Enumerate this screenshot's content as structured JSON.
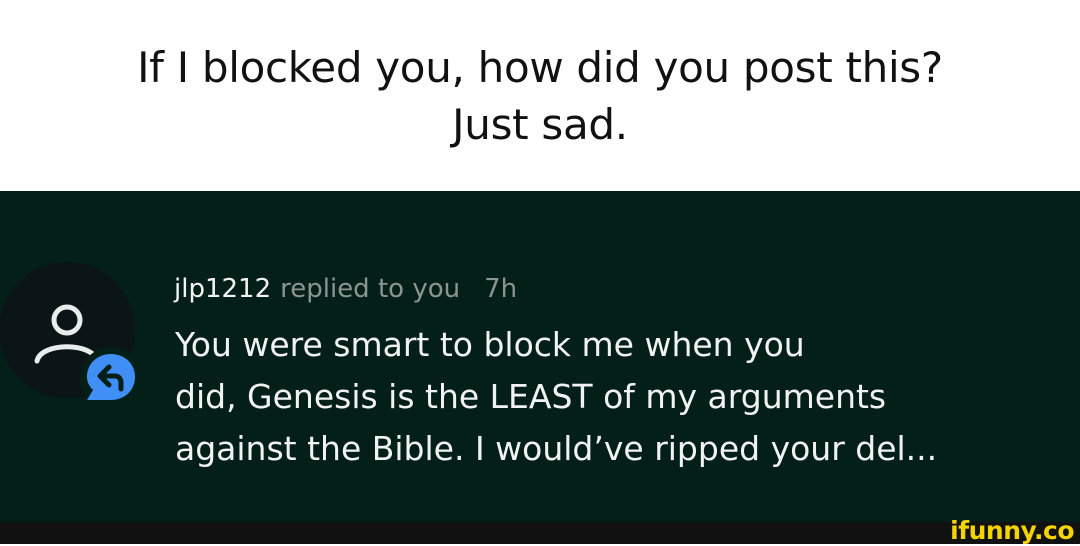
{
  "caption": {
    "line1": "If I blocked you, how did you post this?",
    "line2": "Just sad."
  },
  "notification": {
    "avatar_icon": "person-outline-icon",
    "badge_icon": "reply-arrow-icon",
    "username": "jlp1212",
    "action": "replied to you",
    "time": "7h",
    "message_lines": [
      "You were smart to block me when you",
      "did, Genesis is the LEAST of my arguments",
      "against the Bible. I would’ve ripped your del..."
    ]
  },
  "watermark": {
    "text": "ifunny.co"
  },
  "colors": {
    "caption_background": "#ffffff",
    "notification_background": "#041f18",
    "avatar_background": "#0b1416",
    "reply_badge": "#3f8ff7",
    "username_text": "#f1f4f2",
    "secondary_text": "#8a9590",
    "watermark": "#f4d300"
  }
}
